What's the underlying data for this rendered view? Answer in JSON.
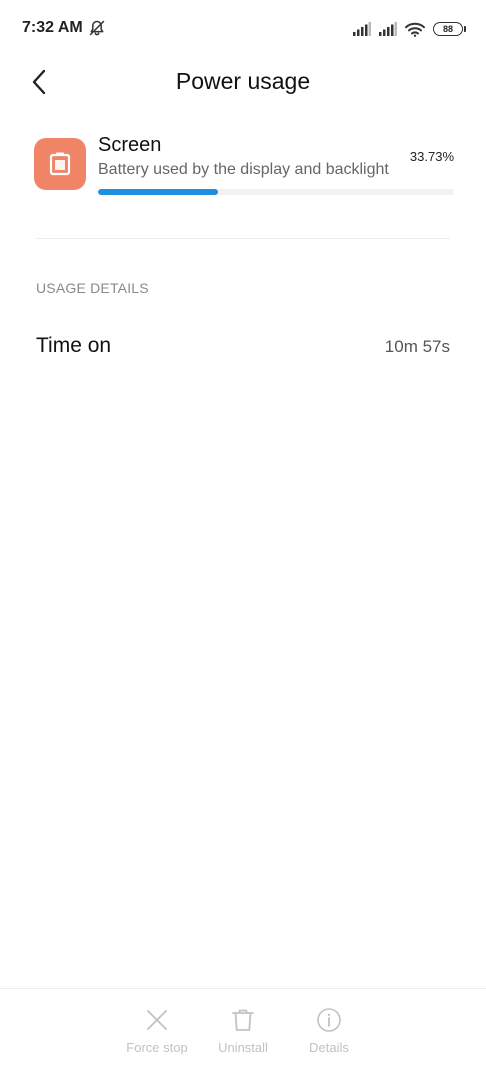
{
  "status_bar": {
    "time": "7:32 AM",
    "battery_level": "88"
  },
  "header": {
    "title": "Power usage"
  },
  "usage_item": {
    "name": "Screen",
    "description": "Battery used by the display and backlight",
    "percent_label": "33.73%",
    "percent_value": 33.73
  },
  "section": {
    "title": "USAGE DETAILS"
  },
  "details": [
    {
      "label": "Time on",
      "value": "10m 57s"
    }
  ],
  "bottom_actions": {
    "force_stop": "Force stop",
    "uninstall": "Uninstall",
    "details": "Details"
  },
  "colors": {
    "accent": "#1e8fe1",
    "icon_bg": "#f08466",
    "disabled": "#c2c2c2"
  },
  "icons": {
    "back": "chevron-left-icon",
    "app": "screen-icon",
    "force_stop": "close-icon",
    "uninstall": "trash-icon",
    "details": "info-icon"
  }
}
